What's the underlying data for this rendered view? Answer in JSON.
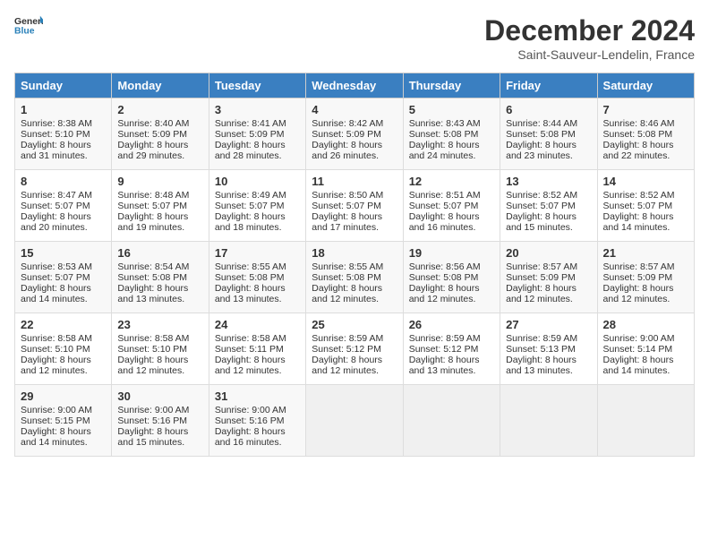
{
  "header": {
    "logo_general": "General",
    "logo_blue": "Blue",
    "month_title": "December 2024",
    "location": "Saint-Sauveur-Lendelin, France"
  },
  "days_of_week": [
    "Sunday",
    "Monday",
    "Tuesday",
    "Wednesday",
    "Thursday",
    "Friday",
    "Saturday"
  ],
  "weeks": [
    [
      {
        "day": "1",
        "sunrise": "8:38 AM",
        "sunset": "5:10 PM",
        "daylight": "8 hours and 31 minutes."
      },
      {
        "day": "2",
        "sunrise": "8:40 AM",
        "sunset": "5:09 PM",
        "daylight": "8 hours and 29 minutes."
      },
      {
        "day": "3",
        "sunrise": "8:41 AM",
        "sunset": "5:09 PM",
        "daylight": "8 hours and 28 minutes."
      },
      {
        "day": "4",
        "sunrise": "8:42 AM",
        "sunset": "5:09 PM",
        "daylight": "8 hours and 26 minutes."
      },
      {
        "day": "5",
        "sunrise": "8:43 AM",
        "sunset": "5:08 PM",
        "daylight": "8 hours and 24 minutes."
      },
      {
        "day": "6",
        "sunrise": "8:44 AM",
        "sunset": "5:08 PM",
        "daylight": "8 hours and 23 minutes."
      },
      {
        "day": "7",
        "sunrise": "8:46 AM",
        "sunset": "5:08 PM",
        "daylight": "8 hours and 22 minutes."
      }
    ],
    [
      {
        "day": "8",
        "sunrise": "8:47 AM",
        "sunset": "5:07 PM",
        "daylight": "8 hours and 20 minutes."
      },
      {
        "day": "9",
        "sunrise": "8:48 AM",
        "sunset": "5:07 PM",
        "daylight": "8 hours and 19 minutes."
      },
      {
        "day": "10",
        "sunrise": "8:49 AM",
        "sunset": "5:07 PM",
        "daylight": "8 hours and 18 minutes."
      },
      {
        "day": "11",
        "sunrise": "8:50 AM",
        "sunset": "5:07 PM",
        "daylight": "8 hours and 17 minutes."
      },
      {
        "day": "12",
        "sunrise": "8:51 AM",
        "sunset": "5:07 PM",
        "daylight": "8 hours and 16 minutes."
      },
      {
        "day": "13",
        "sunrise": "8:52 AM",
        "sunset": "5:07 PM",
        "daylight": "8 hours and 15 minutes."
      },
      {
        "day": "14",
        "sunrise": "8:52 AM",
        "sunset": "5:07 PM",
        "daylight": "8 hours and 14 minutes."
      }
    ],
    [
      {
        "day": "15",
        "sunrise": "8:53 AM",
        "sunset": "5:07 PM",
        "daylight": "8 hours and 14 minutes."
      },
      {
        "day": "16",
        "sunrise": "8:54 AM",
        "sunset": "5:08 PM",
        "daylight": "8 hours and 13 minutes."
      },
      {
        "day": "17",
        "sunrise": "8:55 AM",
        "sunset": "5:08 PM",
        "daylight": "8 hours and 13 minutes."
      },
      {
        "day": "18",
        "sunrise": "8:55 AM",
        "sunset": "5:08 PM",
        "daylight": "8 hours and 12 minutes."
      },
      {
        "day": "19",
        "sunrise": "8:56 AM",
        "sunset": "5:08 PM",
        "daylight": "8 hours and 12 minutes."
      },
      {
        "day": "20",
        "sunrise": "8:57 AM",
        "sunset": "5:09 PM",
        "daylight": "8 hours and 12 minutes."
      },
      {
        "day": "21",
        "sunrise": "8:57 AM",
        "sunset": "5:09 PM",
        "daylight": "8 hours and 12 minutes."
      }
    ],
    [
      {
        "day": "22",
        "sunrise": "8:58 AM",
        "sunset": "5:10 PM",
        "daylight": "8 hours and 12 minutes."
      },
      {
        "day": "23",
        "sunrise": "8:58 AM",
        "sunset": "5:10 PM",
        "daylight": "8 hours and 12 minutes."
      },
      {
        "day": "24",
        "sunrise": "8:58 AM",
        "sunset": "5:11 PM",
        "daylight": "8 hours and 12 minutes."
      },
      {
        "day": "25",
        "sunrise": "8:59 AM",
        "sunset": "5:12 PM",
        "daylight": "8 hours and 12 minutes."
      },
      {
        "day": "26",
        "sunrise": "8:59 AM",
        "sunset": "5:12 PM",
        "daylight": "8 hours and 13 minutes."
      },
      {
        "day": "27",
        "sunrise": "8:59 AM",
        "sunset": "5:13 PM",
        "daylight": "8 hours and 13 minutes."
      },
      {
        "day": "28",
        "sunrise": "9:00 AM",
        "sunset": "5:14 PM",
        "daylight": "8 hours and 14 minutes."
      }
    ],
    [
      {
        "day": "29",
        "sunrise": "9:00 AM",
        "sunset": "5:15 PM",
        "daylight": "8 hours and 14 minutes."
      },
      {
        "day": "30",
        "sunrise": "9:00 AM",
        "sunset": "5:16 PM",
        "daylight": "8 hours and 15 minutes."
      },
      {
        "day": "31",
        "sunrise": "9:00 AM",
        "sunset": "5:16 PM",
        "daylight": "8 hours and 16 minutes."
      },
      null,
      null,
      null,
      null
    ]
  ],
  "labels": {
    "sunrise": "Sunrise:",
    "sunset": "Sunset:",
    "daylight": "Daylight:"
  }
}
